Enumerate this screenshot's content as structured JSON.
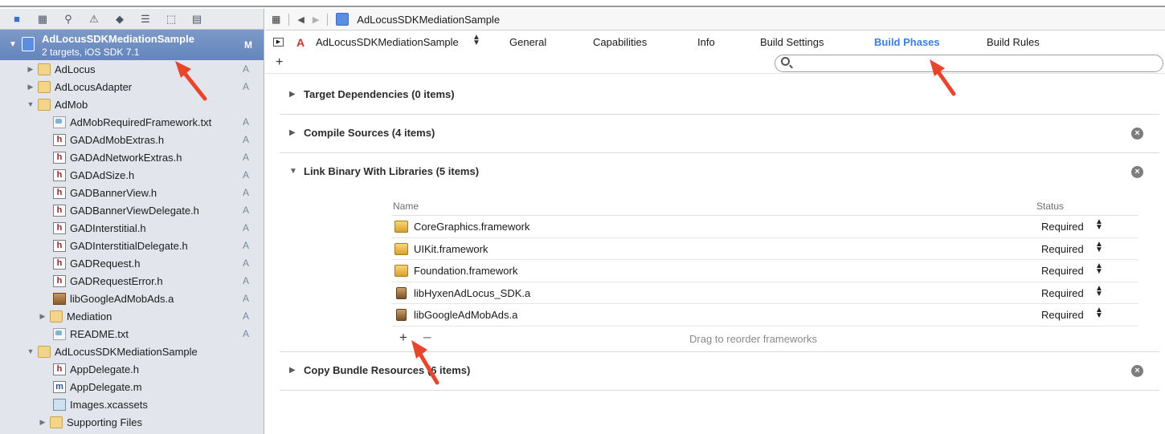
{
  "sidebar": {
    "project": {
      "name": "AdLocusSDKMediationSample",
      "subtitle": "2 targets, iOS SDK 7.1",
      "badge": "M"
    },
    "items": [
      {
        "label": "AdLocus",
        "badge": "A"
      },
      {
        "label": "AdLocusAdapter",
        "badge": "A"
      },
      {
        "label": "AdMob",
        "badge": ""
      },
      {
        "label": "AdMobRequiredFramework.txt",
        "badge": "A"
      },
      {
        "label": "GADAdMobExtras.h",
        "badge": "A"
      },
      {
        "label": "GADAdNetworkExtras.h",
        "badge": "A"
      },
      {
        "label": "GADAdSize.h",
        "badge": "A"
      },
      {
        "label": "GADBannerView.h",
        "badge": "A"
      },
      {
        "label": "GADBannerViewDelegate.h",
        "badge": "A"
      },
      {
        "label": "GADInterstitial.h",
        "badge": "A"
      },
      {
        "label": "GADInterstitialDelegate.h",
        "badge": "A"
      },
      {
        "label": "GADRequest.h",
        "badge": "A"
      },
      {
        "label": "GADRequestError.h",
        "badge": "A"
      },
      {
        "label": "libGoogleAdMobAds.a",
        "badge": "A"
      },
      {
        "label": "Mediation",
        "badge": "A"
      },
      {
        "label": "README.txt",
        "badge": "A"
      },
      {
        "label": "AdLocusSDKMediationSample",
        "badge": ""
      },
      {
        "label": "AppDelegate.h",
        "badge": ""
      },
      {
        "label": "AppDelegate.m",
        "badge": ""
      },
      {
        "label": "Images.xcassets",
        "badge": ""
      },
      {
        "label": "Supporting Files",
        "badge": ""
      }
    ]
  },
  "jumpbar": {
    "crumb": "AdLocusSDKMediationSample"
  },
  "tabs": {
    "target": "AdLocusSDKMediationSample",
    "general": "General",
    "capabilities": "Capabilities",
    "info": "Info",
    "build_settings": "Build Settings",
    "build_phases": "Build Phases",
    "build_rules": "Build Rules",
    "active": "Build Phases"
  },
  "filter": {
    "value": ""
  },
  "phases": {
    "target_dependencies": "Target Dependencies (0 items)",
    "compile_sources": "Compile Sources (4 items)",
    "link_binary": "Link Binary With Libraries (5 items)",
    "copy_bundle": "Copy Bundle Resources (6 items)"
  },
  "libraries": {
    "col_name": "Name",
    "col_status": "Status",
    "rows": [
      {
        "name": "CoreGraphics.framework",
        "status": "Required",
        "kind": "framework"
      },
      {
        "name": "UIKit.framework",
        "status": "Required",
        "kind": "framework"
      },
      {
        "name": "Foundation.framework",
        "status": "Required",
        "kind": "framework"
      },
      {
        "name": "libHyxenAdLocus_SDK.a",
        "status": "Required",
        "kind": "library"
      },
      {
        "name": "libGoogleAdMobAds.a",
        "status": "Required",
        "kind": "library"
      }
    ],
    "drag_hint": "Drag to reorder frameworks"
  },
  "colors": {
    "accent_tab": "#3b7de0",
    "annotation_arrow": "#e8452c",
    "sidebar_selection": "#6f8fc2"
  }
}
